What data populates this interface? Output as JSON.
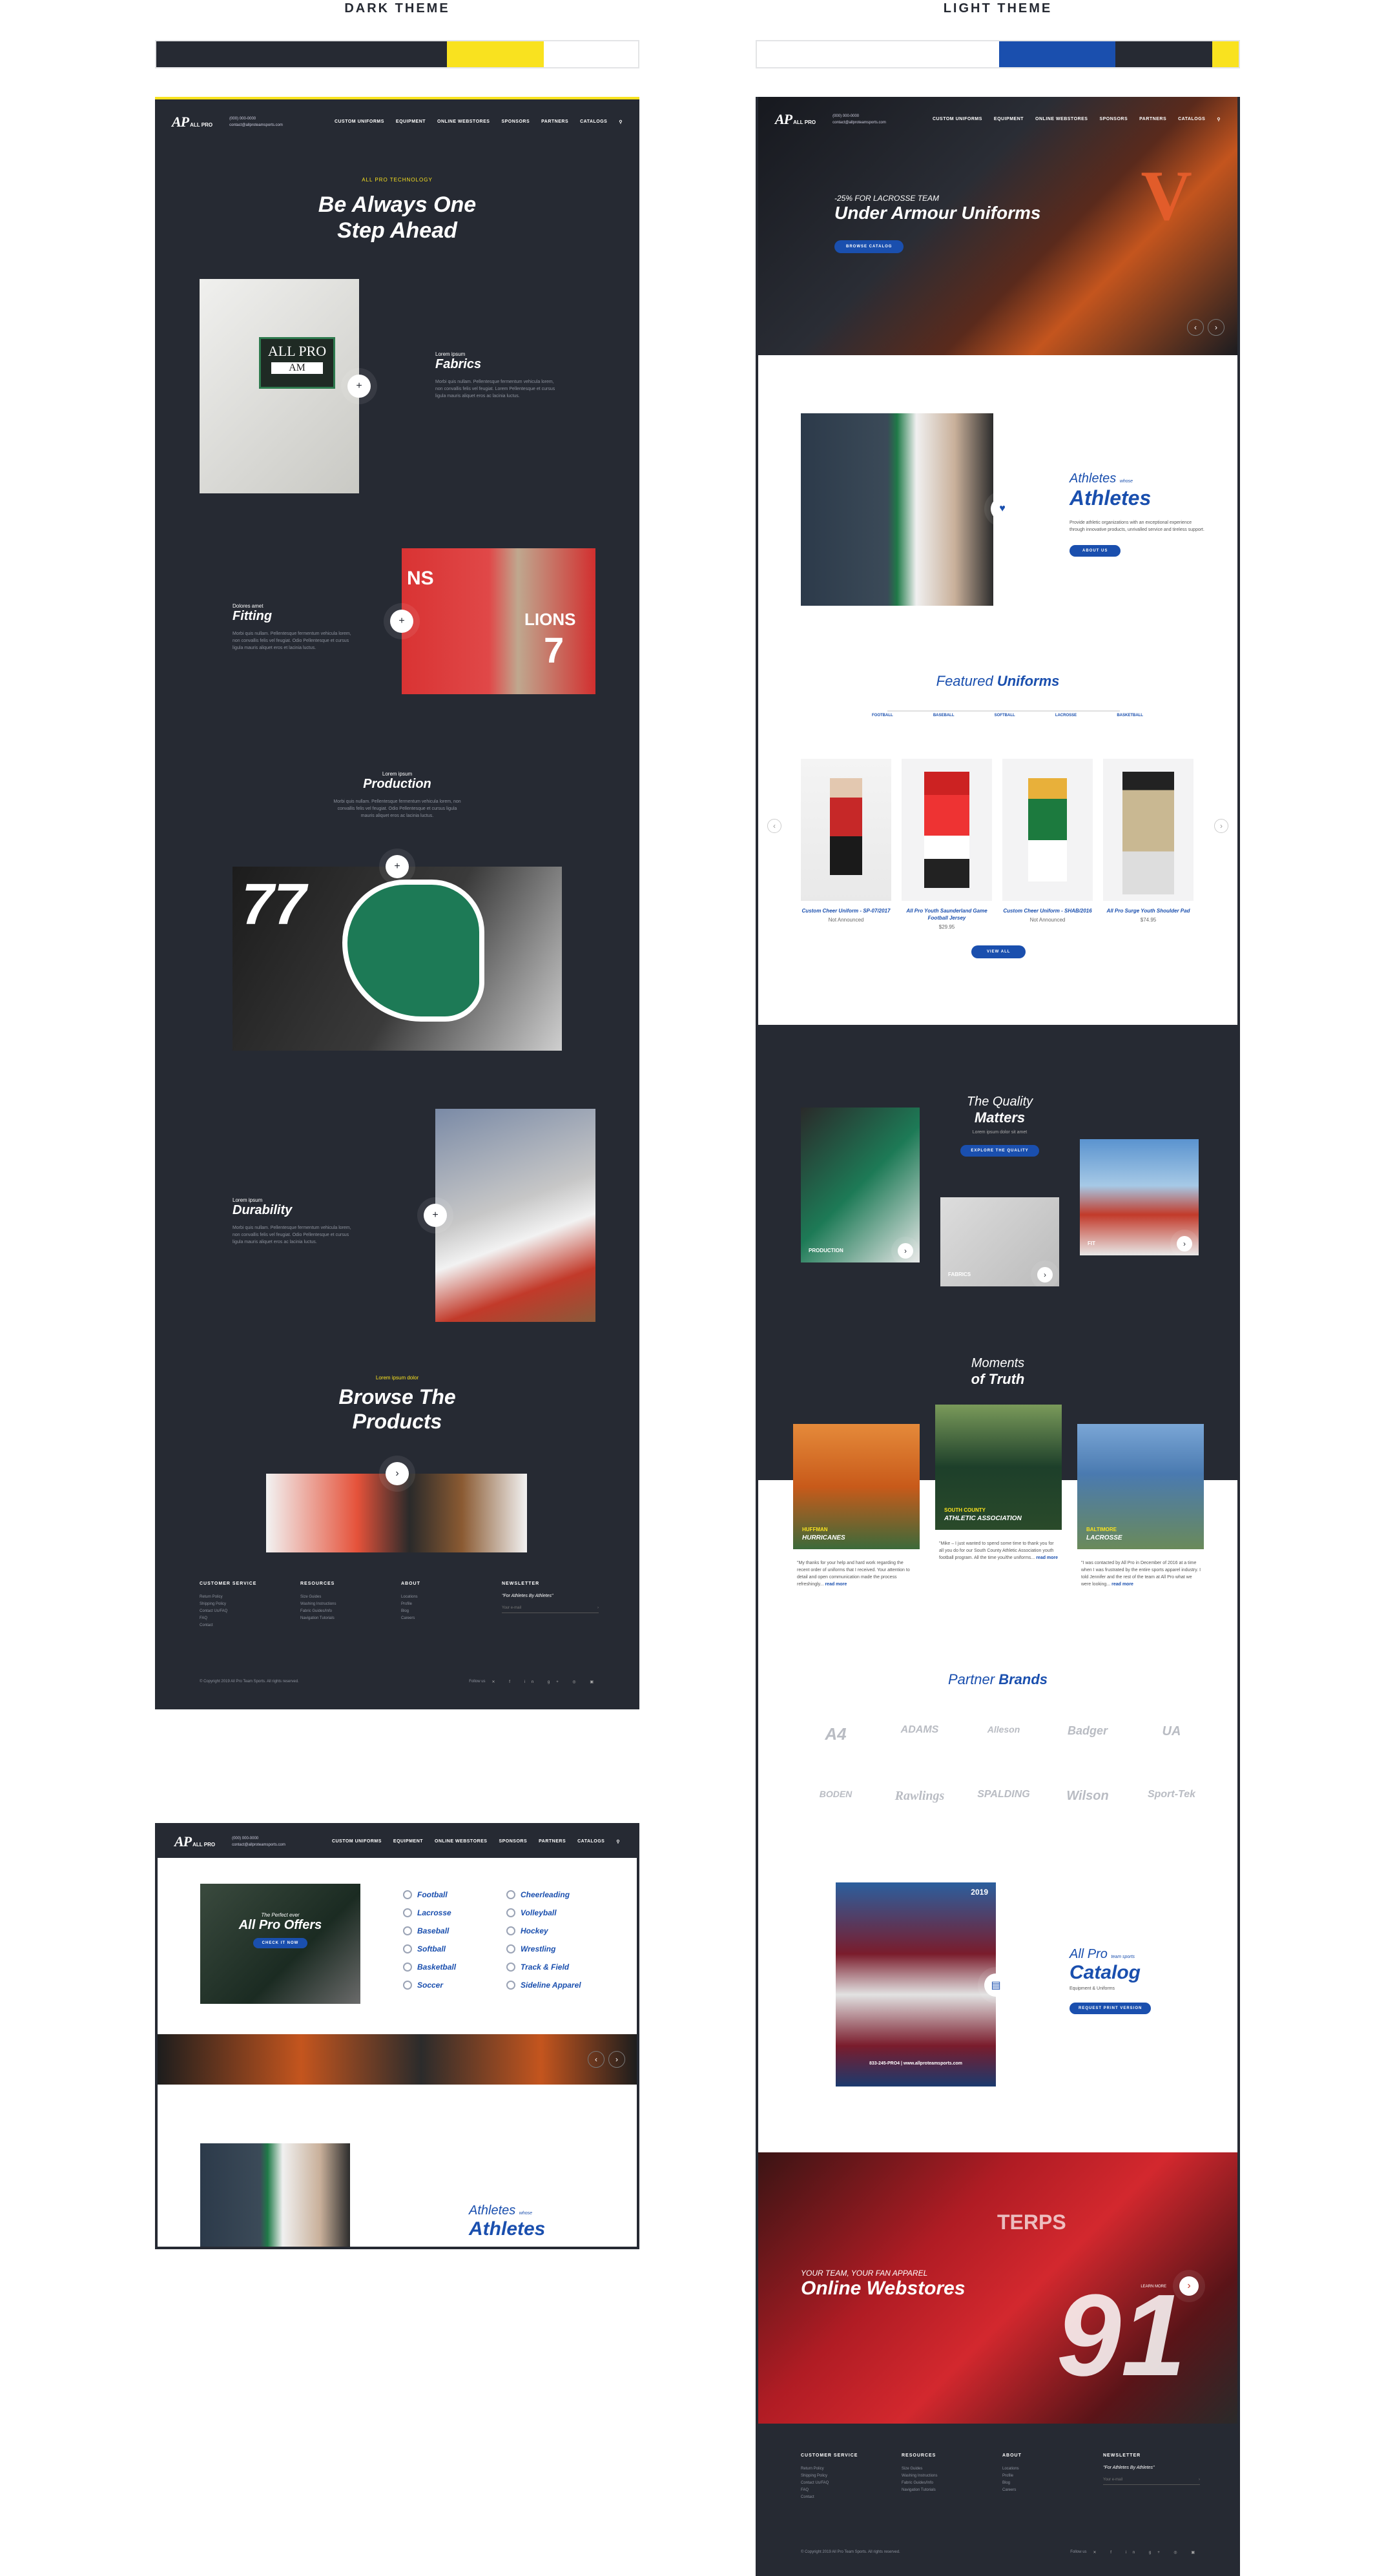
{
  "labels": {
    "dark": "DARK THEME",
    "light": "LIGHT THEME"
  },
  "colors": {
    "dark": "#262a33",
    "yellow": "#f9e21f",
    "blue": "#1a4fae",
    "white": "#ffffff"
  },
  "nav": {
    "logo": "AP",
    "logo_sub": "ALL PRO",
    "phone": "(000) 000-0000",
    "email": "contact@allproteamsports.com",
    "links": [
      "CUSTOM UNIFORMS",
      "EQUIPMENT",
      "ONLINE WEBSTORES",
      "SPONSORS",
      "PARTNERS",
      "CATALOGS"
    ],
    "search_icon": "search-icon"
  },
  "dark": {
    "tech_label": "ALL PRO TECHNOLOGY",
    "hero_l1": "Be Always One",
    "hero_l2": "Step Ahead",
    "fabrics": {
      "pre": "Lorem ipsum",
      "title": "Fabrics",
      "text": "Morbi quis nullam. Pellentesque fermentum vehicula lorem, non convallis felis vel feugiat. Lorem Pellentesque et cursus ligula mauris aliquet eros ac lacinia luctus."
    },
    "fitting": {
      "pre": "Dolores amet",
      "title": "Fitting",
      "text": "Morbi quis nullam. Pellentesque fermentum vehicula lorem, non convallis felis vel feugiat. Odio Pellentesque et cursus ligula mauris aliquet eros et lacinia luctus."
    },
    "production": {
      "pre": "Lorem ipsum",
      "title": "Production",
      "text": "Morbi quis nullam. Pellentesque fermentum vehicula lorem, non convallis felis vel feugiat. Odio Pellentesque et cursus ligula mauris aliquet eros ac lacinia luctus."
    },
    "durability": {
      "pre": "Lorem ipsum",
      "title": "Durability",
      "text": "Morbi quis nullam. Pellentesque fermentum vehicula lorem, non convallis felis vel feugiat. Odio Pellentesque et cursus ligula mauris aliquet eros ac lacinia luctus."
    },
    "browse_pre": "Lorem ipsum dolor",
    "browse_l1": "Browse The",
    "browse_l2": "Products",
    "jersey_tag_top": "ALL PRO",
    "jersey_tag": "AM",
    "jersey_num": "77",
    "red_jersey": "LIONS",
    "red_num": "7",
    "red_jersey2": "NS"
  },
  "footer": {
    "cols": [
      {
        "title": "CUSTOMER SERVICE",
        "items": [
          "Return Policy",
          "Shipping Policy",
          "Contact Us/FAQ",
          "FAQ",
          "Contact"
        ]
      },
      {
        "title": "RESOURCES",
        "items": [
          "Size Guides",
          "Washing Instructions",
          "Fabric Guides/Info",
          "Navigation Tutorials"
        ]
      },
      {
        "title": "ABOUT",
        "items": [
          "Locations",
          "Profile",
          "Blog",
          "Careers"
        ]
      }
    ],
    "newsletter_title": "NEWSLETTER",
    "newsletter_tagline": "\"For Athletes By Athletes\"",
    "email_placeholder": "Your e-mail",
    "copyright": "© Copyright 2019 All Pro Team Sports. All rights reserved.",
    "follow": "Follow us"
  },
  "mega": {
    "offer_pre": "The Perfect ever",
    "offer_title": "All Pro Offers",
    "offer_btn": "CHECK IT NOW",
    "cats_left": [
      "Football",
      "Lacrosse",
      "Baseball",
      "Softball",
      "Basketball",
      "Soccer"
    ],
    "cats_right": [
      "Cheerleading",
      "Volleyball",
      "Hockey",
      "Wrestling",
      "Track & Field",
      "Sideline Apparel"
    ],
    "athletes_pre": "Athletes",
    "athletes_small": "whose",
    "athletes": "Athletes"
  },
  "light": {
    "hero_pre": "-25% FOR LACROSSE TEAM",
    "hero_title": "Under Armour Uniforms",
    "hero_btn": "BROWSE CATALOG",
    "athletes_pre": "Athletes",
    "athletes_small": "whose",
    "athletes": "Athletes",
    "athletes_text": "Provide athletic organizations with an exceptional experience through innovative products, unrivalled service and tireless support.",
    "athletes_btn": "ABOUT US",
    "featured_a": "Featured",
    "featured_b": "Uniforms",
    "tabs": [
      "FOOTBALL",
      "BASEBALL",
      "SOFTBALL",
      "LACROSSE",
      "BASKETBALL"
    ],
    "products": [
      {
        "name": "Custom Cheer Uniform - SP-07/2017",
        "price": "Not Announced"
      },
      {
        "name": "All Pro Youth Saunderland Game Football Jersey",
        "price": "$29.95"
      },
      {
        "name": "Custom Cheer Uniform - SHAB/2016",
        "price": "Not Announced"
      },
      {
        "name": "All Pro Surge Youth Shoulder Pad",
        "price": "$74.95"
      }
    ],
    "view_all": "VIEW ALL",
    "quality_a": "The Quality",
    "quality_b": "Matters",
    "quality_sub": "Lorem ipsum dolor sit amet",
    "quality_btn": "EXPLORE THE QUALITY",
    "q_labels": [
      "PRODUCTION",
      "FABRICS",
      "FIT"
    ],
    "moments_a": "Moments",
    "moments_b": "of Truth",
    "moments": [
      {
        "team": "HUFFMAN",
        "name": "HURRICANES",
        "text": "\"My thanks for your help and hard work regarding the recent order of uniforms that I received. Your attention to detail and open communication made the process refreshingly...",
        "more": "read more"
      },
      {
        "team": "SOUTH COUNTY",
        "name": "ATHLETIC ASSOCIATION",
        "text": "\"Mike – I just wanted to spend some time to thank you for all you do for our South County Athletic Association youth football program. All the time you/the uniforms...",
        "more": "read more"
      },
      {
        "team": "BALTIMORE",
        "name": "LACROSSE",
        "text": "\"I was contacted by All Pro in December of 2016 at a time when I was frustrated by the entire sports apparel industry. I told Jennifer and the rest of the team at All Pro what we were looking...",
        "more": "read more"
      }
    ],
    "partner_a": "Partner",
    "partner_b": "Brands",
    "brands": [
      "A4",
      "ADAMS",
      "Alleson",
      "Badger",
      "UA",
      "BODEN",
      "Rawlings",
      "SPALDING",
      "Wilson",
      "Sport-Tek"
    ],
    "catalog_pre": "All Pro",
    "catalog_small": "team sports",
    "catalog": "Catalog",
    "catalog_sub": "Equipment & Uniforms",
    "catalog_btn": "REQUEST PRINT VERSION",
    "catalog_year": "2019",
    "catalog_phone": "833-245-PRO4 | www.allproteamsports.com",
    "webstore_pre": "YOUR TEAM, YOUR FAN APPAREL",
    "webstore": "Online Webstores",
    "webstore_more": "LEARN MORE",
    "jersey_num": "91",
    "jersey_txt": "TERPS"
  }
}
